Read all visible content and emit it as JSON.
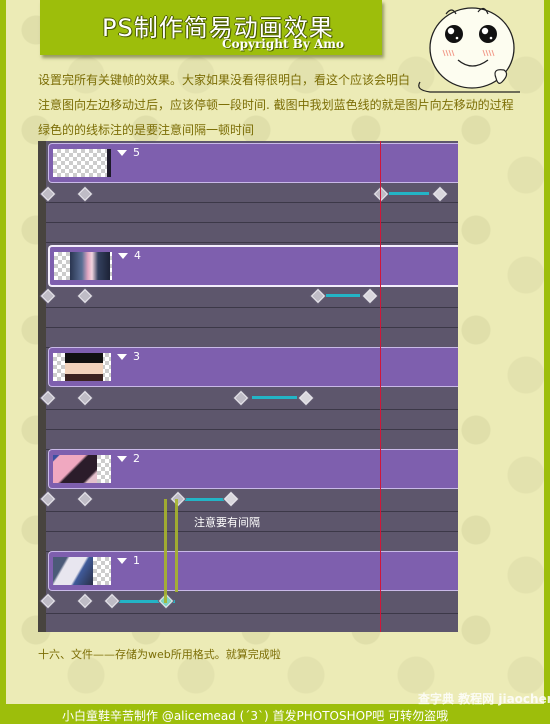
{
  "banner": {
    "title": "PS制作简易动画效果",
    "subtitle": "Copyright By Amo"
  },
  "intro": {
    "lines": [
      "设置完所有关键帧的效果。大家如果没看得很明白，看这个应该会明白",
      "注意图向左边移动过后，应该停顿一段时间. 截图中我划蓝色线的就是图片向左移动的过程",
      "绿色的的线标注的是要注意间隔一顿时间"
    ]
  },
  "timeline": {
    "frames": [
      {
        "number": "5",
        "selected": false,
        "thumbnail": "blank-transparent"
      },
      {
        "number": "4",
        "selected": true,
        "thumbnail": "anime-character-pink"
      },
      {
        "number": "3",
        "selected": false,
        "thumbnail": "anime-character-smiling"
      },
      {
        "number": "2",
        "selected": false,
        "thumbnail": "anime-character-pink-hair"
      },
      {
        "number": "1",
        "selected": false,
        "thumbnail": "anime-character-blue-eye"
      }
    ],
    "annotation": "注意要有间隔",
    "colors": {
      "frame_bar": "#7e5fae",
      "track": "#5d566c",
      "playhead": "#d0163a",
      "motion_line": "#23b4c6",
      "gap_marker": "#a7b52c"
    }
  },
  "step": "十六、文件——存储为web所用格式。就算完成啦",
  "footer": {
    "text": "小白童鞋辛苦制作 @alicemead (ˊ3ˋ) 首发PHOTOSHOP吧 可转勿盗哦",
    "watermark": "查字典 教程网 jiaocheng.chazidian.com"
  }
}
